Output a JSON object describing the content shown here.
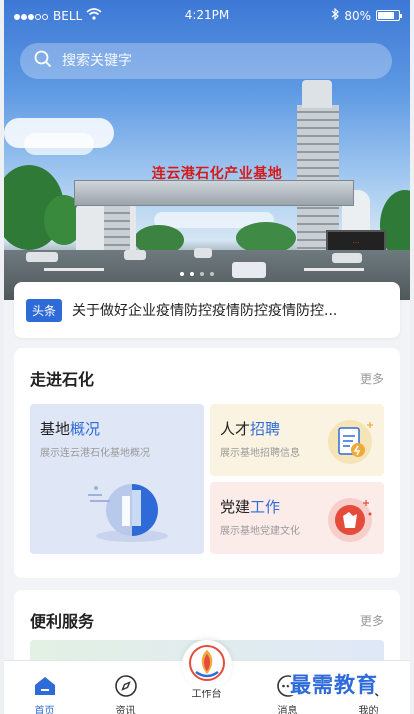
{
  "status_bar": {
    "carrier": "BELL",
    "time": "4:21PM",
    "battery": "80%"
  },
  "search": {
    "placeholder": "搜索关键字"
  },
  "banner": {
    "gate_title": "连云港石化产业基地",
    "led_text": "..."
  },
  "news": {
    "tag": "头条",
    "headline": "关于做好企业疫情防控疫情防控疫情防控..."
  },
  "section1": {
    "title": "走进石化",
    "more": "更多",
    "tiles": [
      {
        "title_plain": "基地",
        "title_accent": "概况",
        "subtitle": "展示连云港石化基地概况"
      },
      {
        "title_plain": "人才",
        "title_accent": "招聘",
        "subtitle": "展示基地招聘信息"
      },
      {
        "title_plain": "党建",
        "title_accent": "工作",
        "subtitle": "展示基地党建文化"
      }
    ]
  },
  "section2": {
    "title": "便利服务",
    "more": "更多"
  },
  "tabbar": {
    "items": [
      {
        "label": "首页",
        "icon": "home-icon",
        "active": true
      },
      {
        "label": "资讯",
        "icon": "compass-icon"
      },
      {
        "label": "工作台",
        "icon": "workbench-logo-icon"
      },
      {
        "label": "消息",
        "icon": "message-icon"
      },
      {
        "label": "我的",
        "icon": "profile-icon"
      }
    ]
  },
  "watermark": "最需教育",
  "colors": {
    "accent": "#2f6bd8",
    "tag_bg": "#2f6bd8",
    "tile_blue": "#dfe6f6",
    "tile_yellow": "#faf3e1",
    "tile_red": "#fbecea"
  }
}
